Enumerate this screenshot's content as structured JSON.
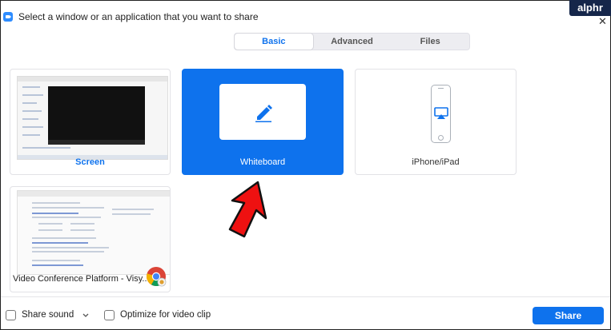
{
  "window": {
    "title": "Select a window or an application that you want to share",
    "logo": "alphr",
    "close_glyph": "✕"
  },
  "tabs": [
    {
      "label": "Basic",
      "active": true
    },
    {
      "label": "Advanced",
      "active": false
    },
    {
      "label": "Files",
      "active": false
    }
  ],
  "tiles": {
    "screen": {
      "label": "Screen",
      "icon": "screen-thumbnail"
    },
    "whiteboard": {
      "label": "Whiteboard",
      "icon": "pencil-icon",
      "selected": true
    },
    "iphone": {
      "label": "iPhone/iPad",
      "icon": "airplay-icon"
    },
    "browser": {
      "label": "Video Conference Platform - Visy...",
      "icon": "chrome-icon"
    }
  },
  "footer": {
    "share_sound_label": "Share sound",
    "share_sound_checked": false,
    "optimize_label": "Optimize for video clip",
    "optimize_checked": false,
    "share_button_label": "Share"
  },
  "colors": {
    "accent": "#0e72ed",
    "arrow": "#ee1111"
  }
}
